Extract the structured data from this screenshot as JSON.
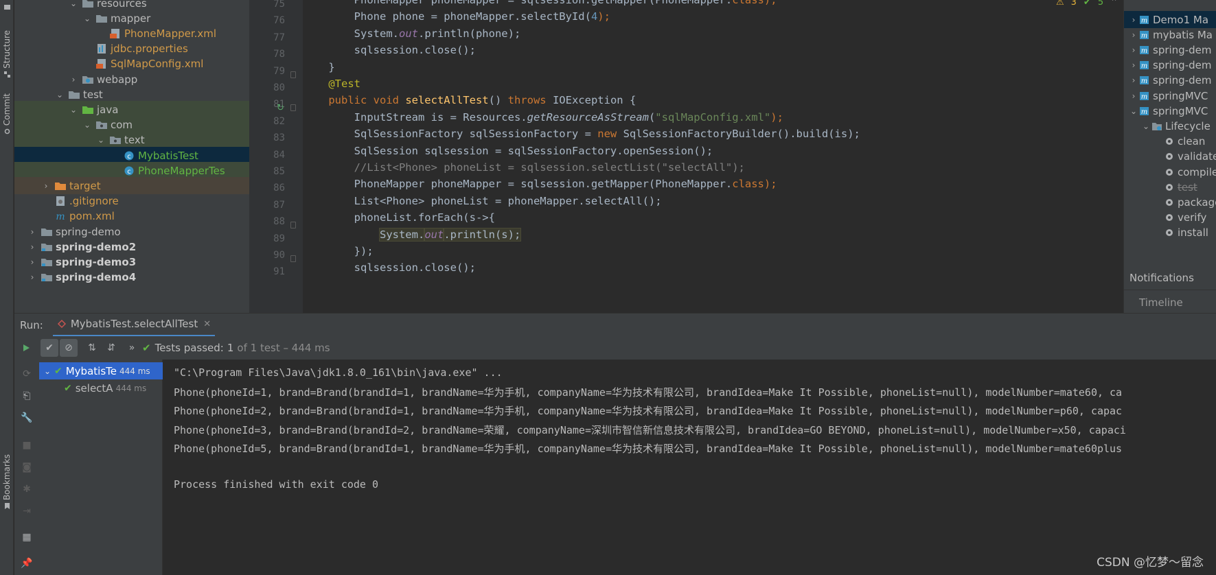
{
  "left_strip": {
    "structure_label": "Structure",
    "commit_label": "Commit",
    "bookmarks_label": "Bookmarks"
  },
  "project_tree": [
    {
      "label": "resources",
      "depth": 4,
      "arrow": "down",
      "icon": "folder-icon",
      "color": "default",
      "hl": ""
    },
    {
      "label": "mapper",
      "depth": 5,
      "arrow": "down",
      "icon": "folder-icon",
      "color": "default",
      "hl": ""
    },
    {
      "label": "PhoneMapper.xml",
      "depth": 6,
      "arrow": "",
      "icon": "xml-file-icon",
      "color": "orange",
      "hl": ""
    },
    {
      "label": "jdbc.properties",
      "depth": 5,
      "arrow": "",
      "icon": "properties-file-icon",
      "color": "orange",
      "hl": ""
    },
    {
      "label": "SqlMapConfig.xml",
      "depth": 5,
      "arrow": "",
      "icon": "xml-file-icon",
      "color": "orange",
      "hl": ""
    },
    {
      "label": "webapp",
      "depth": 4,
      "arrow": "right",
      "icon": "web-folder-icon",
      "color": "default",
      "hl": ""
    },
    {
      "label": "test",
      "depth": 3,
      "arrow": "down",
      "icon": "folder-icon",
      "color": "default",
      "hl": ""
    },
    {
      "label": "java",
      "depth": 4,
      "arrow": "down",
      "icon": "test-folder-icon",
      "color": "default",
      "hl": "green"
    },
    {
      "label": "com",
      "depth": 5,
      "arrow": "down",
      "icon": "package-icon",
      "color": "default",
      "hl": "green"
    },
    {
      "label": "text",
      "depth": 6,
      "arrow": "down",
      "icon": "package-icon",
      "color": "default",
      "hl": "green"
    },
    {
      "label": "MybatisTest",
      "depth": 7,
      "arrow": "",
      "icon": "class-icon",
      "color": "green",
      "hl": "sel"
    },
    {
      "label": "PhoneMapperTes",
      "depth": 7,
      "arrow": "",
      "icon": "class-icon",
      "color": "green",
      "hl": "green"
    },
    {
      "label": "target",
      "depth": 2,
      "arrow": "right",
      "icon": "excluded-folder-icon",
      "color": "orange",
      "hl": "orange"
    },
    {
      "label": ".gitignore",
      "depth": 2,
      "arrow": "",
      "icon": "gitignore-icon",
      "color": "orange",
      "hl": ""
    },
    {
      "label": "pom.xml",
      "depth": 2,
      "arrow": "",
      "icon": "maven-icon",
      "color": "orange",
      "hl": ""
    },
    {
      "label": "spring-demo",
      "depth": 1,
      "arrow": "right",
      "icon": "folder-icon",
      "color": "default",
      "hl": ""
    },
    {
      "label": "spring-demo2",
      "depth": 1,
      "arrow": "right",
      "icon": "module-icon",
      "color": "bold",
      "hl": ""
    },
    {
      "label": "spring-demo3",
      "depth": 1,
      "arrow": "right",
      "icon": "module-icon",
      "color": "bold",
      "hl": ""
    },
    {
      "label": "spring-demo4",
      "depth": 1,
      "arrow": "right",
      "icon": "module-icon",
      "color": "bold",
      "hl": ""
    }
  ],
  "editor": {
    "status_warnings": "3",
    "status_ok": "5",
    "line_numbers": [
      "75",
      "76",
      "77",
      "78",
      "79",
      "80",
      "81",
      "82",
      "83",
      "84",
      "85",
      "86",
      "87",
      "88",
      "89",
      "90",
      "91"
    ],
    "lines": [
      [
        {
          "t": "        PhoneMapper phoneMapper = sqlsession.getMapper(PhoneMapper.",
          "c": ""
        },
        {
          "t": "class",
          "c": "kw"
        },
        {
          "t": ");",
          "c": "kw"
        }
      ],
      [
        {
          "t": "        Phone phone = phoneMapper.selectById(",
          "c": ""
        },
        {
          "t": "4",
          "c": "num"
        },
        {
          "t": ");",
          "c": "kw"
        }
      ],
      [
        {
          "t": "        System.",
          "c": ""
        },
        {
          "t": "out",
          "c": "sf"
        },
        {
          "t": ".println(phone);",
          "c": ""
        }
      ],
      [
        {
          "t": "        sqlsession.close();",
          "c": ""
        }
      ],
      [
        {
          "t": "    }",
          "c": ""
        }
      ],
      [
        {
          "t": "    @Test",
          "c": "ann"
        }
      ],
      [
        {
          "t": "    ",
          "c": ""
        },
        {
          "t": "public void ",
          "c": "kw"
        },
        {
          "t": "selectAllTest",
          "c": "fn"
        },
        {
          "t": "() ",
          "c": ""
        },
        {
          "t": "throws ",
          "c": "kw"
        },
        {
          "t": "IOException {",
          "c": ""
        }
      ],
      [
        {
          "t": "        InputStream is = Resources.",
          "c": ""
        },
        {
          "t": "getResourceAsStream",
          "c": "it"
        },
        {
          "t": "(",
          "c": ""
        },
        {
          "t": "\"sqlMapConfig.xml\"",
          "c": "str"
        },
        {
          "t": ");",
          "c": "kw"
        }
      ],
      [
        {
          "t": "        SqlSessionFactory sqlSessionFactory = ",
          "c": ""
        },
        {
          "t": "new ",
          "c": "kw"
        },
        {
          "t": "SqlSessionFactoryBuilder().build(is);",
          "c": ""
        }
      ],
      [
        {
          "t": "        SqlSession sqlsession = sqlSessionFactory.openSession();",
          "c": ""
        }
      ],
      [
        {
          "t": "        //List<Phone> phoneList = sqlsession.selectList(\"selectAll\");",
          "c": "cmt"
        }
      ],
      [
        {
          "t": "        PhoneMapper phoneMapper = sqlsession.getMapper(PhoneMapper.",
          "c": ""
        },
        {
          "t": "class",
          "c": "kw"
        },
        {
          "t": ");",
          "c": "kw"
        }
      ],
      [
        {
          "t": "        List<Phone> phoneList = phoneMapper.selectAll();",
          "c": ""
        }
      ],
      [
        {
          "t": "        phoneList.forEach(s->{",
          "c": ""
        }
      ],
      [
        {
          "t": "            ",
          "c": ""
        },
        {
          "t": "System.",
          "c": "hl"
        },
        {
          "t": "out",
          "c": "hlsf"
        },
        {
          "t": ".println(s);",
          "c": "hl"
        }
      ],
      [
        {
          "t": "        });",
          "c": ""
        }
      ],
      [
        {
          "t": "        sqlsession.close();",
          "c": ""
        }
      ]
    ]
  },
  "maven": {
    "rows": [
      {
        "label": "Demo1 Ma",
        "depth": 0,
        "arrow": "right",
        "icon": "maven-project-icon",
        "sel": true
      },
      {
        "label": "mybatis Ma",
        "depth": 0,
        "arrow": "right",
        "icon": "maven-project-icon",
        "sel": false
      },
      {
        "label": "spring-dem",
        "depth": 0,
        "arrow": "right",
        "icon": "maven-project-icon",
        "sel": false
      },
      {
        "label": "spring-dem",
        "depth": 0,
        "arrow": "right",
        "icon": "maven-project-icon",
        "sel": false
      },
      {
        "label": "spring-dem",
        "depth": 0,
        "arrow": "right",
        "icon": "maven-project-icon",
        "sel": false
      },
      {
        "label": "springMVC",
        "depth": 0,
        "arrow": "right",
        "icon": "maven-project-icon",
        "sel": false
      },
      {
        "label": "springMVC",
        "depth": 0,
        "arrow": "down",
        "icon": "maven-project-icon",
        "sel": false
      },
      {
        "label": "Lifecycle",
        "depth": 1,
        "arrow": "down",
        "icon": "lifecycle-folder-icon",
        "sel": false
      },
      {
        "label": "clean",
        "depth": 2,
        "arrow": "",
        "icon": "gear-icon",
        "sel": false
      },
      {
        "label": "validate",
        "depth": 2,
        "arrow": "",
        "icon": "gear-icon",
        "sel": false
      },
      {
        "label": "compile",
        "depth": 2,
        "arrow": "",
        "icon": "gear-icon",
        "sel": false
      },
      {
        "label": "test",
        "depth": 2,
        "arrow": "",
        "icon": "gear-icon",
        "sel": false,
        "strike": true
      },
      {
        "label": "package",
        "depth": 2,
        "arrow": "",
        "icon": "gear-icon",
        "sel": false
      },
      {
        "label": "verify",
        "depth": 2,
        "arrow": "",
        "icon": "gear-icon",
        "sel": false
      },
      {
        "label": "install",
        "depth": 2,
        "arrow": "",
        "icon": "gear-icon",
        "sel": false
      }
    ],
    "notifications_label": "Notifications",
    "timeline_label": "Timeline"
  },
  "run": {
    "run_label": "Run:",
    "tab_label": "MybatisTest.selectAllTest",
    "tests_passed_label": "Tests passed:",
    "tests_passed_count": "1",
    "tests_passed_detail": "of 1 test – 444 ms",
    "tree": [
      {
        "label": "MybatisTe",
        "time": "444 ms",
        "depth": 0
      },
      {
        "label": "selectA",
        "time": "444 ms",
        "depth": 1
      }
    ],
    "console": [
      "\"C:\\Program Files\\Java\\jdk1.8.0_161\\bin\\java.exe\" ...",
      "Phone(phoneId=1, brand=Brand(brandId=1, brandName=华为手机, companyName=华为技术有限公司, brandIdea=Make It Possible, phoneList=null), modelNumber=mate60, ca",
      "Phone(phoneId=2, brand=Brand(brandId=1, brandName=华为手机, companyName=华为技术有限公司, brandIdea=Make It Possible, phoneList=null), modelNumber=p60, capac",
      "Phone(phoneId=3, brand=Brand(brandId=2, brandName=荣耀, companyName=深圳市智信新信息技术有限公司, brandIdea=GO BEYOND, phoneList=null), modelNumber=x50, capaci",
      "Phone(phoneId=5, brand=Brand(brandId=1, brandName=华为手机, companyName=华为技术有限公司, brandIdea=Make It Possible, phoneList=null), modelNumber=mate60plus",
      "",
      "Process finished with exit code 0"
    ]
  },
  "watermark": "CSDN @忆梦～留念"
}
